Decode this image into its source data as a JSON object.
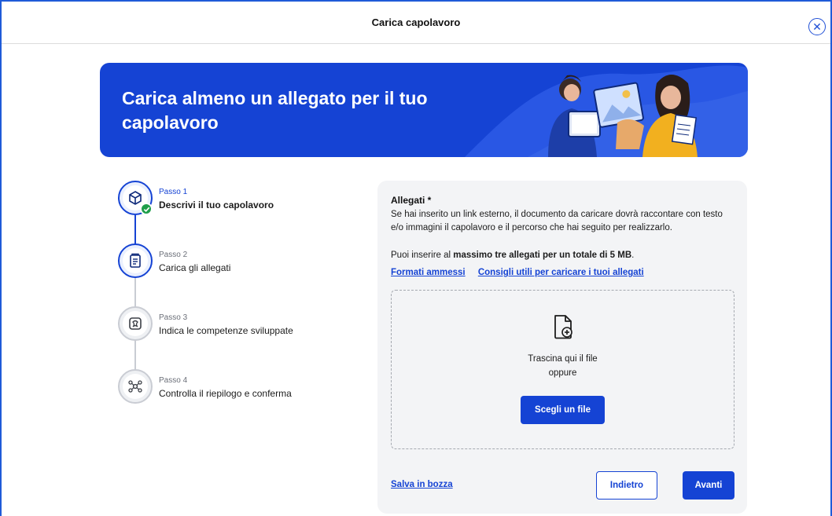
{
  "header": {
    "title": "Carica capolavoro",
    "close_icon": "close-circle-icon"
  },
  "banner": {
    "title": "Carica almeno un allegato per il tuo capolavoro",
    "background": "#1543d4"
  },
  "stepper": {
    "steps": [
      {
        "kicker": "Passo 1",
        "name": "Descrivi il tuo capolavoro",
        "state": "completed",
        "icon": "cube-icon"
      },
      {
        "kicker": "Passo 2",
        "name": "Carica gli allegati",
        "state": "active",
        "icon": "upload-document-icon"
      },
      {
        "kicker": "Passo 3",
        "name": "Indica le competenze sviluppate",
        "state": "todo",
        "icon": "puzzle-icon"
      },
      {
        "kicker": "Passo 4",
        "name": "Controlla il riepilogo e conferma",
        "state": "todo",
        "icon": "network-icon"
      }
    ]
  },
  "panel": {
    "label": "Allegati *",
    "description": "Se hai inserito un link esterno, il documento da caricare dovrà raccontare con testo e/o immagini il capolavoro e il percorso che hai seguito per realizzarlo.",
    "limit_prefix": "Puoi inserire al ",
    "limit_bold": "massimo tre allegati per un totale di 5 MB",
    "limit_suffix": ".",
    "link_formats": "Formati ammessi",
    "link_tips": "Consigli utili per caricare i tuoi allegati",
    "dropzone": {
      "icon": "file-add-icon",
      "line1": "Trascina qui il file",
      "line2": "oppure",
      "button": "Scegli un file"
    }
  },
  "footer": {
    "save_draft": "Salva in bozza",
    "back": "Indietro",
    "next": "Avanti"
  },
  "colors": {
    "accent": "#1543d4",
    "success": "#1e9e4a",
    "panel_bg": "#f3f4f6"
  }
}
